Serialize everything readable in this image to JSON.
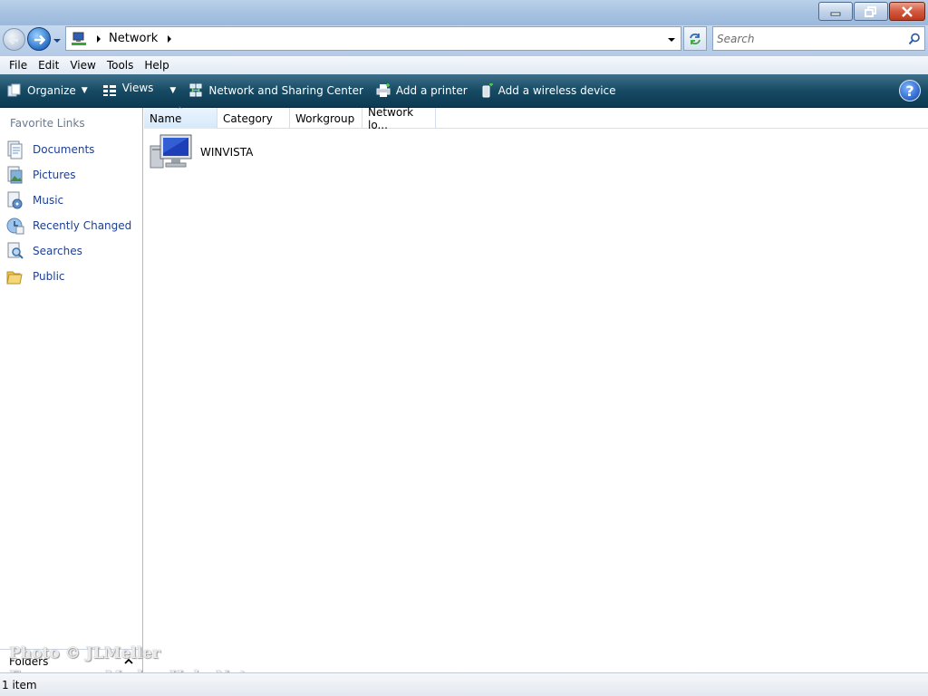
{
  "window": {
    "controls": {
      "minimize": "minimize",
      "maximize": "restore",
      "close": "close"
    }
  },
  "address": {
    "location_icon": "network-icon",
    "path": [
      "Network"
    ],
    "search_placeholder": "Search"
  },
  "menu": [
    "File",
    "Edit",
    "View",
    "Tools",
    "Help"
  ],
  "command_bar": {
    "organize": "Organize",
    "views": "Views",
    "network_sharing": "Network and Sharing Center",
    "add_printer": "Add a printer",
    "add_wireless": "Add a wireless device",
    "help_icon": "help-icon"
  },
  "sidebar": {
    "title": "Favorite Links",
    "items": [
      {
        "label": "Documents",
        "icon": "documents-icon"
      },
      {
        "label": "Pictures",
        "icon": "pictures-icon"
      },
      {
        "label": "Music",
        "icon": "music-icon"
      },
      {
        "label": "Recently Changed",
        "icon": "recently-changed-icon"
      },
      {
        "label": "Searches",
        "icon": "searches-icon"
      },
      {
        "label": "Public",
        "icon": "public-folder-icon"
      }
    ],
    "folders_label": "Folders"
  },
  "columns": [
    "Name",
    "Category",
    "Workgroup",
    "Network lo..."
  ],
  "items": [
    {
      "name": "WINVISTA",
      "icon": "computer-icon"
    }
  ],
  "status": {
    "text": "1 item"
  },
  "watermark": {
    "line1": "Photo © JLMeller",
    "line2": "For use on ModemHelp.Net"
  },
  "colors": {
    "command_bar": "#174a63",
    "link": "#1c3f94",
    "title_bar": "#a7c2e1"
  }
}
